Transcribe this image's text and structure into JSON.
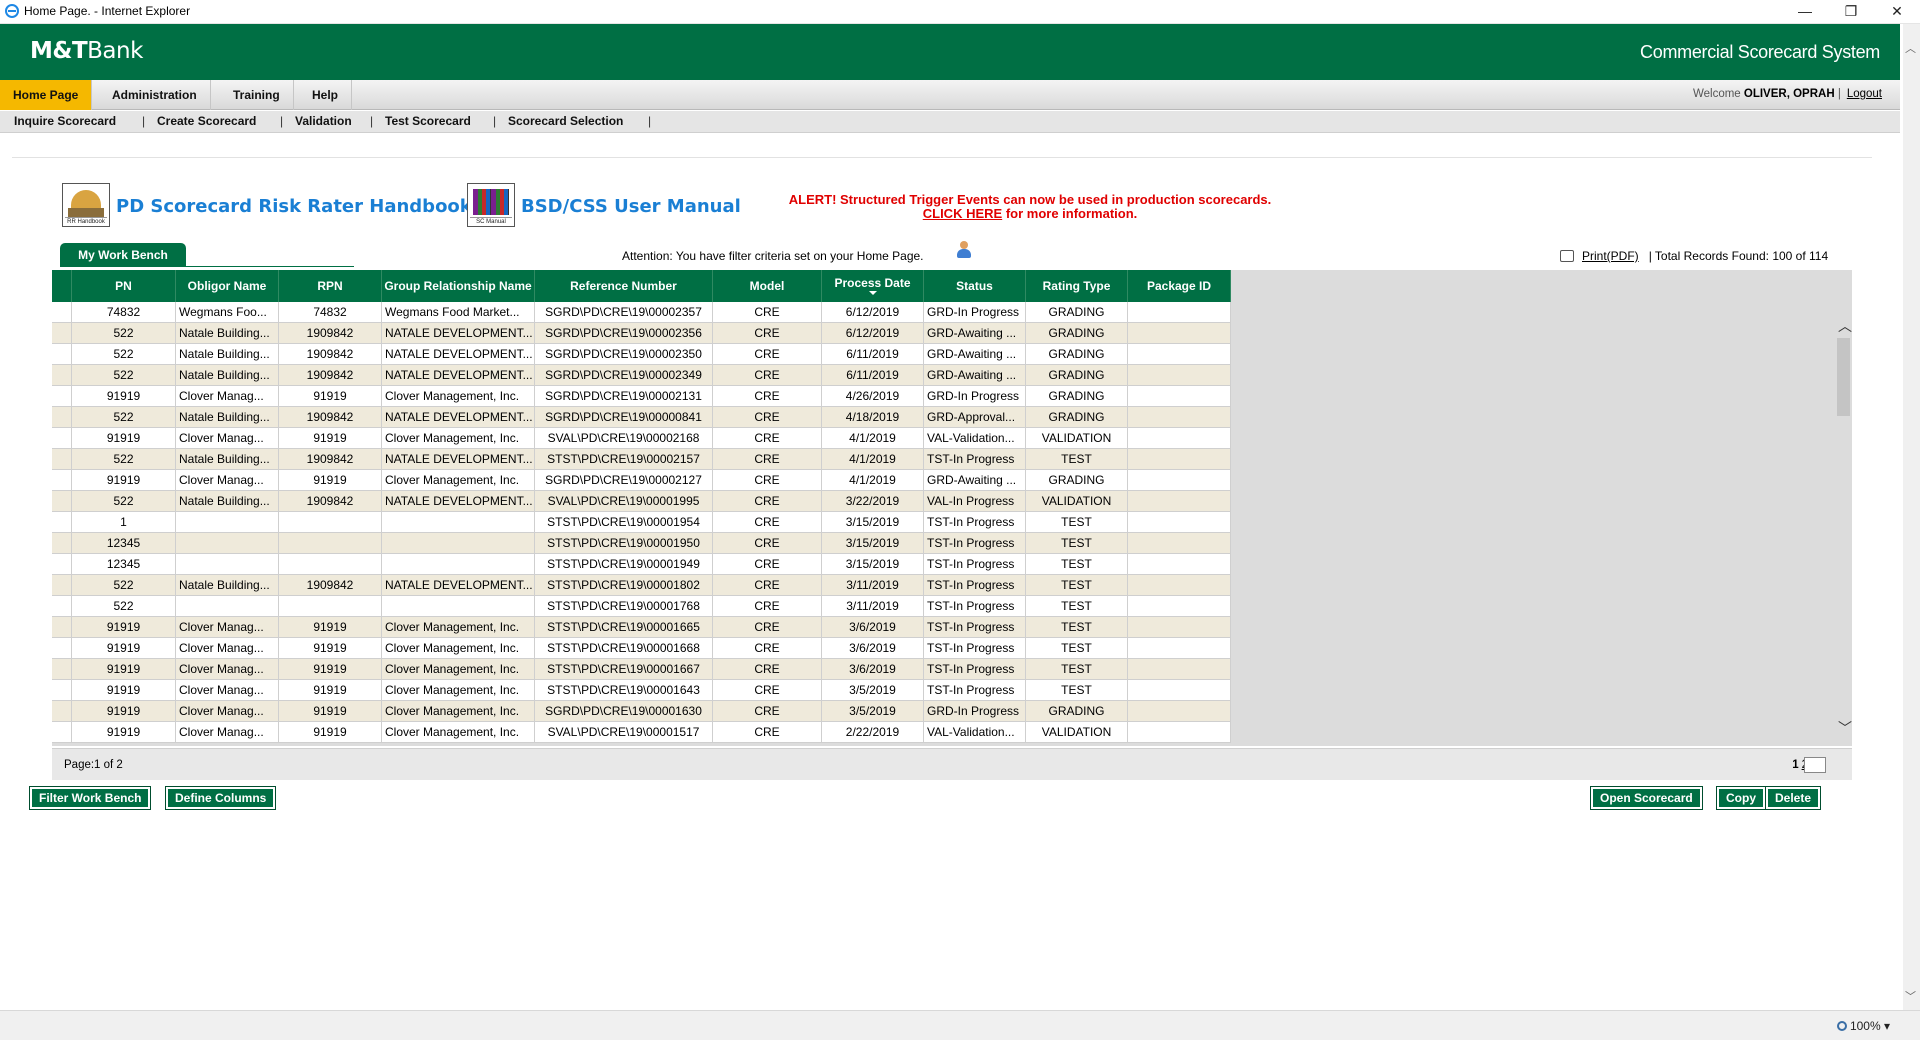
{
  "window": {
    "title": "Home Page. - Internet Explorer",
    "minimize": "—",
    "restore": "❐",
    "close": "✕"
  },
  "header": {
    "logo_bold": "M&T",
    "logo_rest": "Bank",
    "system_name": "Commercial Scorecard System"
  },
  "nav": {
    "items": [
      "Home Page",
      "Administration",
      "Training",
      "Help"
    ],
    "welcome_prefix": "Welcome",
    "user": "OLIVER, OPRAH",
    "logout": "Logout"
  },
  "subnav": [
    "Inquire Scorecard",
    "Create Scorecard",
    "Validation",
    "Test Scorecard",
    "Scorecard Selection"
  ],
  "manuals": {
    "rr_label": "PD Scorecard Risk Rater Handbook",
    "rr_caption": "RR Handbook",
    "bsd_label": "BSD/CSS User Manual",
    "bsd_caption": "SC Manual"
  },
  "alert": {
    "line1": "ALERT! Structured Trigger Events can now be used in production scorecards.",
    "link": "CLICK HERE",
    "line2_rest": "for more information."
  },
  "workbench": {
    "tab": "My Work Bench",
    "attention": "Attention: You have filter criteria set on your Home Page.",
    "print": "Print(PDF)",
    "total": "|  Total Records Found: 100 of 114"
  },
  "grid": {
    "columns": [
      "PN",
      "Obligor Name",
      "RPN",
      "Group Relationship Name",
      "Reference Number",
      "Model",
      "Process Date",
      "Status",
      "Rating Type",
      "Package ID"
    ],
    "rows": [
      [
        "74832",
        "Wegmans Foo...",
        "74832",
        "Wegmans Food Market...",
        "SGRD\\PD\\CRE\\19\\00002357",
        "CRE",
        "6/12/2019",
        "GRD-In Progress",
        "GRADING",
        ""
      ],
      [
        "522",
        "Natale Building...",
        "1909842",
        "NATALE DEVELOPMENT...",
        "SGRD\\PD\\CRE\\19\\00002356",
        "CRE",
        "6/12/2019",
        "GRD-Awaiting ...",
        "GRADING",
        ""
      ],
      [
        "522",
        "Natale Building...",
        "1909842",
        "NATALE DEVELOPMENT...",
        "SGRD\\PD\\CRE\\19\\00002350",
        "CRE",
        "6/11/2019",
        "GRD-Awaiting ...",
        "GRADING",
        ""
      ],
      [
        "522",
        "Natale Building...",
        "1909842",
        "NATALE DEVELOPMENT...",
        "SGRD\\PD\\CRE\\19\\00002349",
        "CRE",
        "6/11/2019",
        "GRD-Awaiting ...",
        "GRADING",
        ""
      ],
      [
        "91919",
        "Clover Manag...",
        "91919",
        "Clover Management, Inc.",
        "SGRD\\PD\\CRE\\19\\00002131",
        "CRE",
        "4/26/2019",
        "GRD-In Progress",
        "GRADING",
        ""
      ],
      [
        "522",
        "Natale Building...",
        "1909842",
        "NATALE DEVELOPMENT...",
        "SGRD\\PD\\CRE\\19\\00000841",
        "CRE",
        "4/18/2019",
        "GRD-Approval...",
        "GRADING",
        ""
      ],
      [
        "91919",
        "Clover Manag...",
        "91919",
        "Clover Management, Inc.",
        "SVAL\\PD\\CRE\\19\\00002168",
        "CRE",
        "4/1/2019",
        "VAL-Validation...",
        "VALIDATION",
        ""
      ],
      [
        "522",
        "Natale Building...",
        "1909842",
        "NATALE DEVELOPMENT...",
        "STST\\PD\\CRE\\19\\00002157",
        "CRE",
        "4/1/2019",
        "TST-In Progress",
        "TEST",
        ""
      ],
      [
        "91919",
        "Clover Manag...",
        "91919",
        "Clover Management, Inc.",
        "SGRD\\PD\\CRE\\19\\00002127",
        "CRE",
        "4/1/2019",
        "GRD-Awaiting ...",
        "GRADING",
        ""
      ],
      [
        "522",
        "Natale Building...",
        "1909842",
        "NATALE DEVELOPMENT...",
        "SVAL\\PD\\CRE\\19\\00001995",
        "CRE",
        "3/22/2019",
        "VAL-In Progress",
        "VALIDATION",
        ""
      ],
      [
        "1",
        "",
        "",
        "",
        "STST\\PD\\CRE\\19\\00001954",
        "CRE",
        "3/15/2019",
        "TST-In Progress",
        "TEST",
        ""
      ],
      [
        "12345",
        "",
        "",
        "",
        "STST\\PD\\CRE\\19\\00001950",
        "CRE",
        "3/15/2019",
        "TST-In Progress",
        "TEST",
        ""
      ],
      [
        "12345",
        "",
        "",
        "",
        "STST\\PD\\CRE\\19\\00001949",
        "CRE",
        "3/15/2019",
        "TST-In Progress",
        "TEST",
        ""
      ],
      [
        "522",
        "Natale Building...",
        "1909842",
        "NATALE DEVELOPMENT...",
        "STST\\PD\\CRE\\19\\00001802",
        "CRE",
        "3/11/2019",
        "TST-In Progress",
        "TEST",
        ""
      ],
      [
        "522",
        "",
        "",
        "",
        "STST\\PD\\CRE\\19\\00001768",
        "CRE",
        "3/11/2019",
        "TST-In Progress",
        "TEST",
        ""
      ],
      [
        "91919",
        "Clover Manag...",
        "91919",
        "Clover Management, Inc.",
        "STST\\PD\\CRE\\19\\00001665",
        "CRE",
        "3/6/2019",
        "TST-In Progress",
        "TEST",
        ""
      ],
      [
        "91919",
        "Clover Manag...",
        "91919",
        "Clover Management, Inc.",
        "STST\\PD\\CRE\\19\\00001668",
        "CRE",
        "3/6/2019",
        "TST-In Progress",
        "TEST",
        ""
      ],
      [
        "91919",
        "Clover Manag...",
        "91919",
        "Clover Management, Inc.",
        "STST\\PD\\CRE\\19\\00001667",
        "CRE",
        "3/6/2019",
        "TST-In Progress",
        "TEST",
        ""
      ],
      [
        "91919",
        "Clover Manag...",
        "91919",
        "Clover Management, Inc.",
        "STST\\PD\\CRE\\19\\00001643",
        "CRE",
        "3/5/2019",
        "TST-In Progress",
        "TEST",
        ""
      ],
      [
        "91919",
        "Clover Manag...",
        "91919",
        "Clover Management, Inc.",
        "SGRD\\PD\\CRE\\19\\00001630",
        "CRE",
        "3/5/2019",
        "GRD-In Progress",
        "GRADING",
        ""
      ],
      [
        "91919",
        "Clover Manag...",
        "91919",
        "Clover Management, Inc.",
        "SVAL\\PD\\CRE\\19\\00001517",
        "CRE",
        "2/22/2019",
        "VAL-Validation...",
        "VALIDATION",
        ""
      ]
    ]
  },
  "pager": {
    "page": "Page:1 of 2",
    "current": "1",
    "next": "2"
  },
  "buttons": {
    "filter": "Filter Work Bench",
    "define": "Define Columns",
    "open": "Open Scorecard",
    "copy": "Copy",
    "delete": "Delete"
  },
  "status": {
    "zoom": "100%"
  }
}
